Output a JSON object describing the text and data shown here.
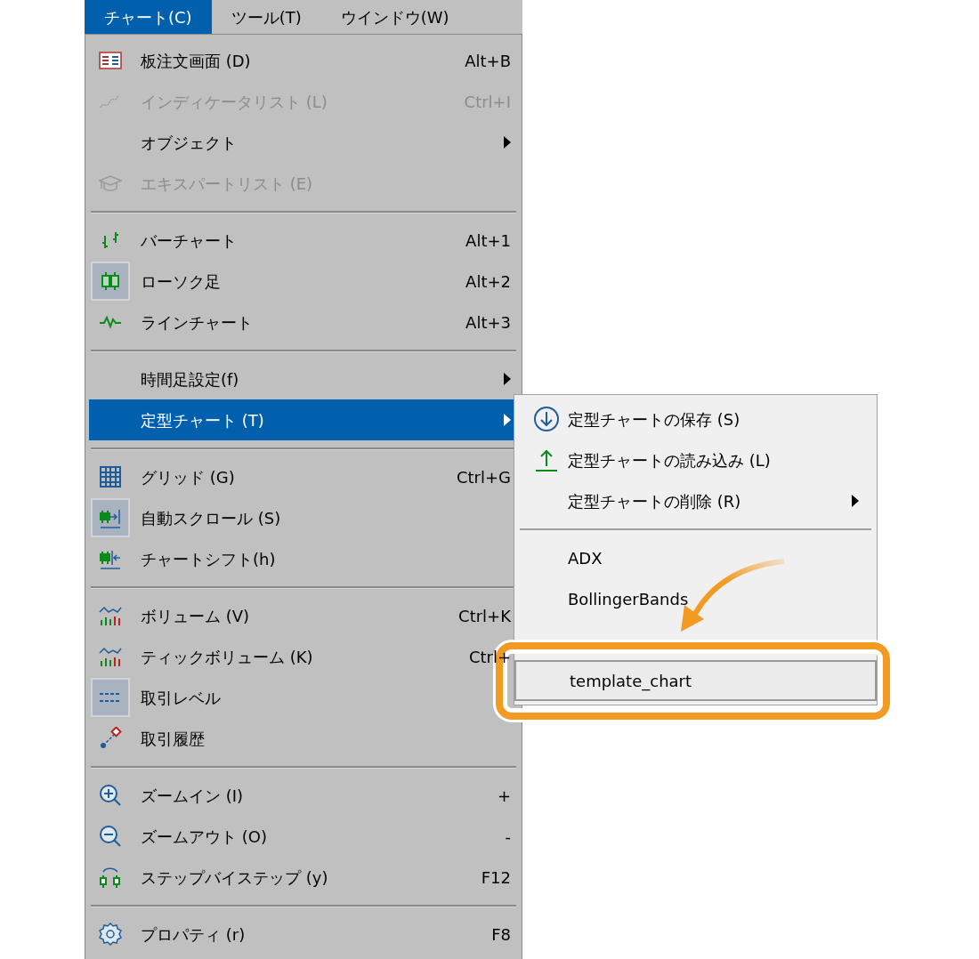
{
  "menu_bar": [
    {
      "label": "チャート(C)",
      "selected": true
    },
    {
      "label": "ツール(T)",
      "selected": false
    },
    {
      "label": "ウインドウ(W)",
      "selected": false
    }
  ],
  "menu": [
    {
      "kind": "item",
      "label": "板注文画面 (D)",
      "shortcut": "Alt+B",
      "disabled": false,
      "checked": false,
      "submenu": false,
      "selected": false
    },
    {
      "kind": "item",
      "label": "インディケータリスト (L)",
      "shortcut": "Ctrl+I",
      "disabled": true,
      "checked": false,
      "submenu": false,
      "selected": false
    },
    {
      "kind": "item",
      "label": "オブジェクト",
      "disabled": false,
      "checked": false,
      "submenu": true,
      "selected": false
    },
    {
      "kind": "item",
      "label": "エキスパートリスト (E)",
      "disabled": true,
      "checked": false,
      "submenu": false,
      "selected": false
    },
    {
      "kind": "separator"
    },
    {
      "kind": "item",
      "label": "バーチャート",
      "shortcut": "Alt+1",
      "disabled": false,
      "checked": false,
      "submenu": false,
      "selected": false
    },
    {
      "kind": "item",
      "label": "ローソク足",
      "shortcut": "Alt+2",
      "disabled": false,
      "checked": true,
      "submenu": false,
      "selected": false
    },
    {
      "kind": "item",
      "label": "ラインチャート",
      "shortcut": "Alt+3",
      "disabled": false,
      "checked": false,
      "submenu": false,
      "selected": false
    },
    {
      "kind": "separator"
    },
    {
      "kind": "item",
      "label": "時間足設定(f)",
      "disabled": false,
      "checked": false,
      "submenu": true,
      "selected": false
    },
    {
      "kind": "item",
      "label": "定型チャート (T)",
      "disabled": false,
      "checked": false,
      "submenu": true,
      "selected": true
    },
    {
      "kind": "separator"
    },
    {
      "kind": "item",
      "label": "グリッド (G)",
      "shortcut": "Ctrl+G",
      "disabled": false,
      "checked": false,
      "submenu": false,
      "selected": false
    },
    {
      "kind": "item",
      "label": "自動スクロール (S)",
      "disabled": false,
      "checked": true,
      "submenu": false,
      "selected": false
    },
    {
      "kind": "item",
      "label": "チャートシフト(h)",
      "disabled": false,
      "checked": false,
      "submenu": false,
      "selected": false
    },
    {
      "kind": "separator"
    },
    {
      "kind": "item",
      "label": "ボリューム (V)",
      "shortcut": "Ctrl+K",
      "disabled": false,
      "checked": false,
      "submenu": false,
      "selected": false
    },
    {
      "kind": "item",
      "label": "ティックボリューム (K)",
      "shortcut": "Ctrl+",
      "disabled": false,
      "checked": false,
      "submenu": false,
      "selected": false
    },
    {
      "kind": "item",
      "label": "取引レベル",
      "disabled": false,
      "checked": true,
      "submenu": false,
      "selected": false
    },
    {
      "kind": "item",
      "label": "取引履歴",
      "disabled": false,
      "checked": false,
      "submenu": false,
      "selected": false
    },
    {
      "kind": "separator"
    },
    {
      "kind": "item",
      "label": "ズームイン (I)",
      "shortcut": "+",
      "disabled": false,
      "checked": false,
      "submenu": false,
      "selected": false
    },
    {
      "kind": "item",
      "label": "ズームアウト (O)",
      "shortcut": "-",
      "disabled": false,
      "checked": false,
      "submenu": false,
      "selected": false
    },
    {
      "kind": "item",
      "label": "ステップバイステップ (y)",
      "shortcut": "F12",
      "disabled": false,
      "checked": false,
      "submenu": false,
      "selected": false
    },
    {
      "kind": "separator"
    },
    {
      "kind": "item",
      "label": "プロパティ (r)",
      "shortcut": "F8",
      "disabled": false,
      "checked": false,
      "submenu": false,
      "selected": false
    }
  ],
  "submenu": [
    {
      "kind": "item",
      "label": "定型チャートの保存 (S)",
      "submenu": false,
      "selected": false
    },
    {
      "kind": "item",
      "label": "定型チャートの読み込み (L)",
      "submenu": false,
      "selected": false
    },
    {
      "kind": "item",
      "label": "定型チャートの削除 (R)",
      "submenu": true,
      "selected": false
    },
    {
      "kind": "separator"
    },
    {
      "kind": "item",
      "label": "ADX",
      "submenu": false,
      "selected": false
    },
    {
      "kind": "item",
      "label": "BollingerBands",
      "submenu": false,
      "selected": false
    },
    {
      "kind": "covered"
    },
    {
      "kind": "item",
      "label": "template_chart",
      "submenu": false,
      "selected": true
    }
  ],
  "callout": {
    "kind": "highlight"
  }
}
